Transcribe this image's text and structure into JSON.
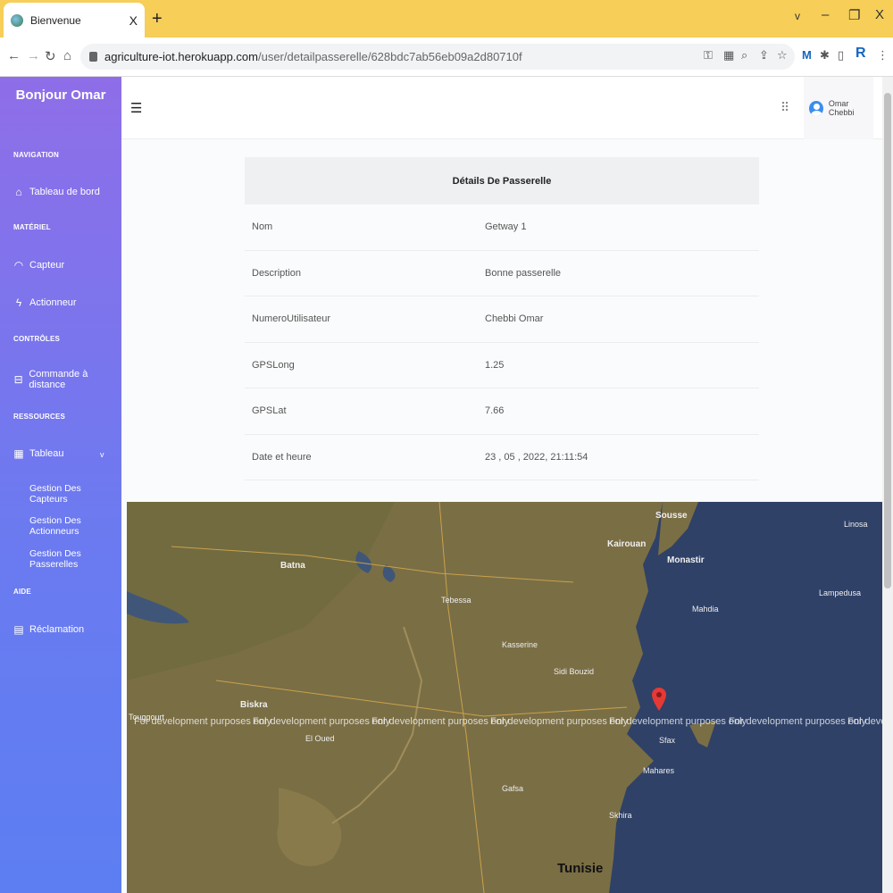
{
  "browser": {
    "tab_title": "Bienvenue",
    "tab_close": "X",
    "new_tab": "+",
    "url_host": "agriculture-iot.herokuapp.com",
    "url_path": "/user/detailpasserelle/628bdc7ab56eb09a2d80710f",
    "window_min": "–",
    "window_restore": "❐",
    "window_close": "X",
    "window_menu": "v"
  },
  "sidebar": {
    "brand": "Bonjour Omar",
    "sections": {
      "navigation": "NAVIGATION",
      "materiel": "MATÉRIEL",
      "controles": "CONTRÔLES",
      "ressources": "RESSOURCES",
      "aide": "AIDE"
    },
    "items": {
      "dashboard": "Tableau de bord",
      "capteur": "Capteur",
      "actionneur": "Actionneur",
      "commande": "Commande à distance",
      "tableau": "Tableau",
      "reclamation": "Réclamation"
    },
    "subitems": {
      "capteurs": "Gestion Des Capteurs",
      "actionneurs": "Gestion Des Actionneurs",
      "passerelles": "Gestion Des Passerelles"
    }
  },
  "topbar": {
    "user_name": "Omar Chebbi"
  },
  "details": {
    "title": "Détails De Passerelle",
    "rows": [
      {
        "label": "Nom",
        "value": "Getway 1"
      },
      {
        "label": "Description",
        "value": "Bonne passerelle"
      },
      {
        "label": "NumeroUtilisateur",
        "value": "Chebbi Omar"
      },
      {
        "label": "GPSLong",
        "value": "1.25"
      },
      {
        "label": "GPSLat",
        "value": "7.66"
      },
      {
        "label": "Date et heure",
        "value": "23 , 05 , 2022, 21:11:54"
      }
    ]
  },
  "map": {
    "watermark": "For development purposes only",
    "labels": [
      "Sousse",
      "Kairouan",
      "Monastir",
      "Batna",
      "Mahdia",
      "Biskra",
      "Sidi Bouzid",
      "Kasserine",
      "Tebessa",
      "Gafsa",
      "Sfax",
      "Mahares",
      "Tunisie",
      "Lampedusa",
      "Linosa",
      "El Oued",
      "Touggourt",
      "Skhira"
    ],
    "colors": {
      "sea": "#2f4167",
      "land": "#7a6e45",
      "marker": "#e53935"
    }
  }
}
